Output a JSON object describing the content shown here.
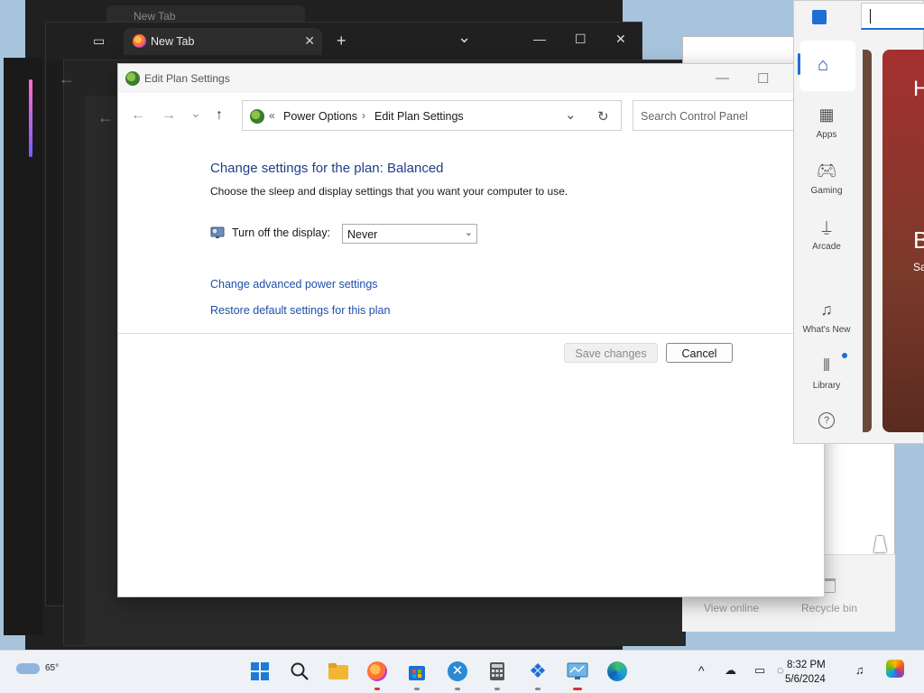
{
  "background_browser": {
    "tab_label": "New Tab",
    "tab_close": "✕",
    "new_tab": "+",
    "dropdown": "⌄",
    "minimize": "—",
    "maximize": "☐",
    "close": "✕"
  },
  "background_explorer": {
    "view_online": "View online",
    "recycle_bin": "Recycle bin"
  },
  "window": {
    "title": "Edit Plan Settings",
    "minimize": "—",
    "maximize": "☐"
  },
  "address_bar": {
    "chevrons": "«",
    "crumb1": "Power Options",
    "separator": "›",
    "crumb2": "Edit Plan Settings",
    "dropdown": "⌄",
    "refresh": "↻"
  },
  "nav": {
    "back": "←",
    "forward": "→",
    "recent": "⌄",
    "up": "↑"
  },
  "search": {
    "placeholder": "Search Control Panel"
  },
  "content": {
    "heading": "Change settings for the plan: Balanced",
    "subtext": "Choose the sleep and display settings that you want your computer to use.",
    "display_label": "Turn off the display:",
    "display_value": "Never",
    "link_advanced": "Change advanced power settings",
    "link_restore": "Restore default settings for this plan",
    "save_button": "Save changes",
    "cancel_button": "Cancel"
  },
  "store": {
    "nav": [
      {
        "label": "Apps"
      },
      {
        "label": "Gaming"
      },
      {
        "label": "Arcade"
      },
      {
        "label": "What's New"
      },
      {
        "label": "Library"
      }
    ],
    "help": "?",
    "card_h": "H",
    "card_b": "B",
    "card_sa": "Sa"
  },
  "taskbar": {
    "temperature": "65°",
    "time": "8:32 PM",
    "date": "5/6/2024",
    "up_arrow": "^"
  },
  "colors": {
    "link": "#1e4fa8",
    "heading": "#1e3f8a",
    "accent": "#1f6ed4"
  }
}
